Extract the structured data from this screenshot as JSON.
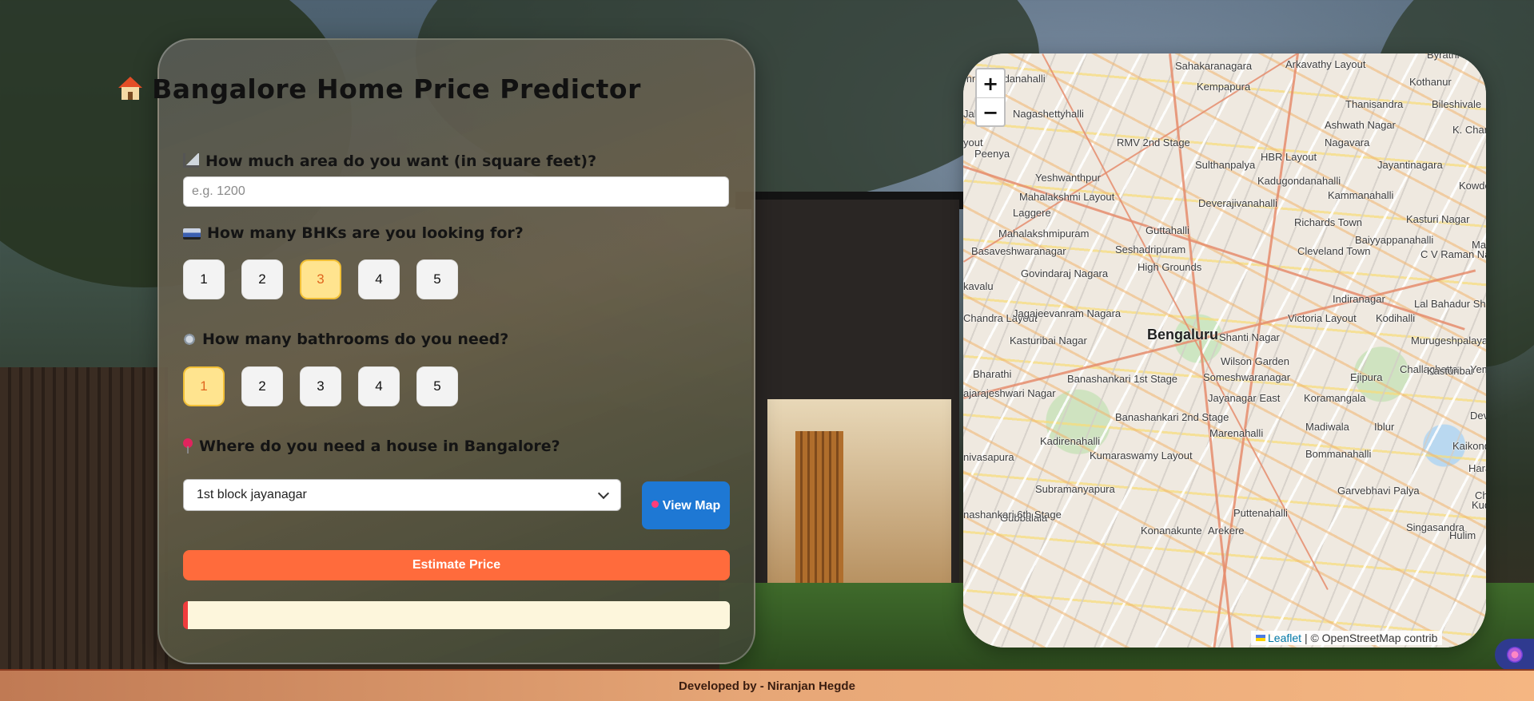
{
  "app": {
    "title": "Bangalore Home Price Predictor",
    "title_icon": "house-icon"
  },
  "form": {
    "area": {
      "label": "How much area do you want (in square feet)?",
      "icon": "ruler-icon",
      "placeholder": "e.g. 1200",
      "value": ""
    },
    "bhk": {
      "label": "How many BHKs are you looking for?",
      "icon": "bed-icon",
      "options": [
        "1",
        "2",
        "3",
        "4",
        "5"
      ],
      "selected": "3"
    },
    "bath": {
      "label": "How many bathrooms do you need?",
      "icon": "bathtub-icon",
      "options": [
        "1",
        "2",
        "3",
        "4",
        "5"
      ],
      "selected": "1"
    },
    "location": {
      "label": "Where do you need a house in Bangalore?",
      "icon": "pin-icon",
      "selected": "1st block jayanagar"
    },
    "view_map_label": "View Map",
    "estimate_label": "Estimate Price",
    "result_text": ""
  },
  "map": {
    "zoom_in": "+",
    "zoom_out": "−",
    "attribution_leaflet": "Leaflet",
    "attribution_rest": "| © OpenStreetMap contrib",
    "city_label": "Bengaluru",
    "place_labels": [
      "Sahakaranagara",
      "Arkavathy Layout",
      "Byrathi Bande",
      "mmagondanahalli",
      "Kempapura",
      "Kothanur",
      "Thanisandra",
      "Bileshivale",
      "Jalahalli",
      "Nagashettyhalli",
      "Ashwath Nagar",
      "K. Channas",
      "RMV 2nd Stage",
      "Nagavara",
      "HBR Layout",
      "Peenya",
      "Sulthanpalya",
      "Jayantinagara",
      "Yeshwanthpur",
      "Kadugondanahalli",
      "Kowdena",
      "Mahalakshmi Layout",
      "Kammanahalli",
      "Laggere",
      "Deverajivanahalli",
      "Kasturi Nagar",
      "Richards Town",
      "Mahalakshmipuram",
      "Guttahalli",
      "Baiyyappanahalli",
      "Basaveshwaranagar",
      "Seshadripuram",
      "Cleveland Town",
      "C V Raman Nagar",
      "High Grounds",
      "Govindaraj Nagara",
      "Indiranagar",
      "Lal Bahadur Shastri Nagar",
      "Chandra Layout",
      "Jagajeevanram Nagara",
      "Victoria Layout",
      "Kodihalli",
      "Kasturibai Nagar",
      "Shanti Nagar",
      "Murugeshpalaya",
      "Wilson Garden",
      "Banashankari 1st Stage",
      "Someshwaranagar",
      "Ejipura",
      "Challaghatta",
      "Yemal",
      "Jayanagar East",
      "Koramangala",
      "Banashankari 2nd Stage",
      "Devara",
      "Madiwala",
      "Iblur",
      "Kadirenahalli",
      "Marenahalli",
      "Kumaraswamy Layout",
      "Bommanahalli",
      "Kaikondrah",
      "Haralur",
      "Subramanyapura",
      "Garvebhavi Palya",
      "Puttenahalli",
      "Kudlu",
      "Gubbalala",
      "Arekere",
      "Singasandra",
      "Konanakunte",
      "Hulim",
      "nashankari 6th Stage",
      "nivasapura",
      "ajarajeshwari Nagar",
      "Bharathi",
      "yout",
      "kavalu",
      "Ma",
      "Kasturibai",
      "Chil"
    ]
  },
  "footer": {
    "text": "Developed by - Niranjan Hegde"
  }
}
